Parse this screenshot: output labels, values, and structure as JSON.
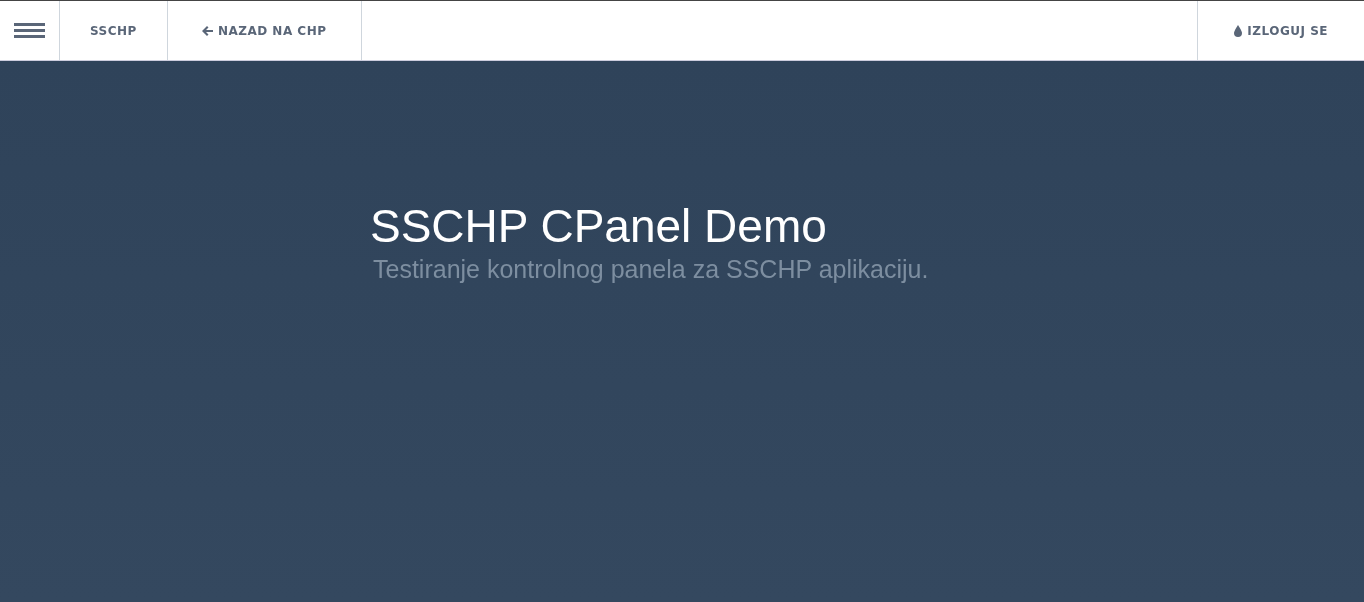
{
  "navbar": {
    "brand": "SSCHP",
    "back_link": "NAZAD NA CHP",
    "logout": "IZLOGUJ SE"
  },
  "hero": {
    "title": "SSCHP CPanel Demo",
    "subtitle": "Testiranje kontrolnog panela za SSCHP aplikaciju."
  }
}
